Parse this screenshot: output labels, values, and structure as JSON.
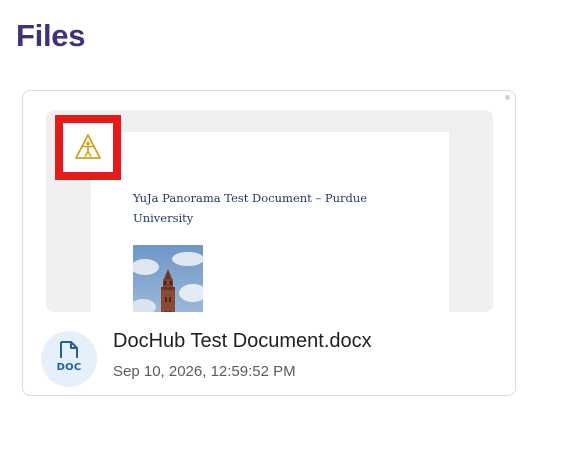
{
  "section": {
    "title": "Files"
  },
  "file_card": {
    "file_name": "DocHub Test Document.docx",
    "date": "Sep 10, 2026, 12:59:52 PM",
    "file_type_label": "DOC",
    "file_type_icon": "doc-file-icon",
    "preview": {
      "document_title": "YuJa Panorama Test Document – Purdue University",
      "image": "tower-photo"
    },
    "accessibility_icon": "accessibility-warning-icon",
    "highlight_color": "#e31b1b",
    "accessibility_icon_color": "#d4a017"
  },
  "colors": {
    "title": "#41307a",
    "doc_title": "#1f3a6b",
    "file_icon_bg": "#e6f0fa",
    "file_icon_fg": "#1e5fa8"
  }
}
